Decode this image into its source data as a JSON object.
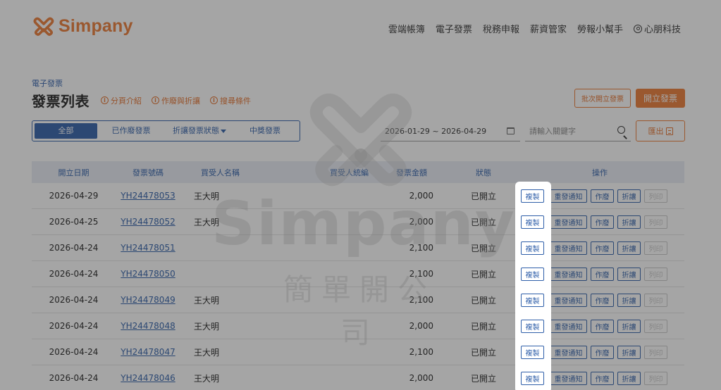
{
  "brand": {
    "name": "Simpany",
    "color": "#ec7a34"
  },
  "nav": {
    "items": [
      "雲端帳簿",
      "電子發票",
      "稅務申報",
      "薪資管家",
      "勞報小幫手"
    ],
    "user": "心朋科技"
  },
  "breadcrumb": "電子發票",
  "page_title": "發票列表",
  "help_links": [
    "分頁介紹",
    "作廢與折讓",
    "搜尋條件"
  ],
  "buttons": {
    "batch": "批次開立發票",
    "issue": "開立發票",
    "export": "匯出"
  },
  "tabs": [
    {
      "label": "全部",
      "active": true
    },
    {
      "label": "已作廢發票",
      "active": false
    },
    {
      "label": "折讓發票狀態",
      "active": false,
      "dropdown": true
    },
    {
      "label": "中獎發票",
      "active": false
    }
  ],
  "filters": {
    "date_range": "2026-01-29 ~ 2026-04-29",
    "search_placeholder": "請輸入關鍵字"
  },
  "table": {
    "headers": [
      "開立日期",
      "發票號碼",
      "買受人名稱",
      "買受人統編",
      "發票金額",
      "狀態",
      "操作"
    ],
    "actions": [
      "複製",
      "重發通知",
      "作廢",
      "折讓",
      "列印"
    ],
    "rows": [
      {
        "date": "2026-04-29",
        "number": "YH24478053",
        "buyer": "王大明",
        "ban": "",
        "amount": "2,000",
        "status": "已開立"
      },
      {
        "date": "2026-04-25",
        "number": "YH24478052",
        "buyer": "王大明",
        "ban": "",
        "amount": "2,000",
        "status": "已開立"
      },
      {
        "date": "2026-04-24",
        "number": "YH24478051",
        "buyer": "",
        "ban": "",
        "amount": "2,100",
        "status": "已開立"
      },
      {
        "date": "2026-04-24",
        "number": "YH24478050",
        "buyer": "",
        "ban": "",
        "amount": "2,100",
        "status": "已開立"
      },
      {
        "date": "2026-04-24",
        "number": "YH24478049",
        "buyer": "王大明",
        "ban": "",
        "amount": "2,100",
        "status": "已開立"
      },
      {
        "date": "2026-04-24",
        "number": "YH24478048",
        "buyer": "王大明",
        "ban": "",
        "amount": "2,000",
        "status": "已開立"
      },
      {
        "date": "2026-04-24",
        "number": "YH24478047",
        "buyer": "王大明",
        "ban": "",
        "amount": "2,100",
        "status": "已開立"
      },
      {
        "date": "2026-04-24",
        "number": "YH24478046",
        "buyer": "王大明",
        "ban": "",
        "amount": "2,000",
        "status": "已開立"
      }
    ]
  },
  "watermark": {
    "word": "Simpany",
    "sub": "簡單開公司"
  },
  "colors": {
    "accent": "#ec7a34",
    "primary": "#2f5fa9",
    "header_bg": "#e8edf5",
    "overlay": "rgba(40,40,40,0.42)"
  }
}
